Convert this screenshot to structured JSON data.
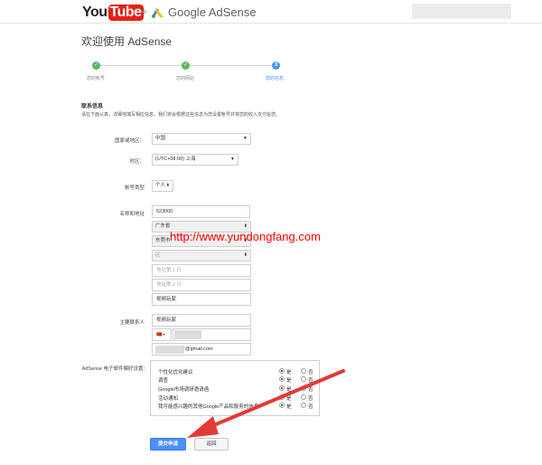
{
  "header": {
    "youtube_you": "You",
    "youtube_tube": "Tube",
    "tm": "™",
    "plus": "+",
    "adsense_title": "Google AdSense"
  },
  "page_title": "欢迎使用 AdSense",
  "steps": [
    {
      "label": "您的帐号",
      "status": "done",
      "mark": "✓"
    },
    {
      "label": "您的网站",
      "status": "done",
      "mark": "✓"
    },
    {
      "label": "您的信息",
      "status": "current",
      "mark": "3"
    }
  ],
  "contact": {
    "heading": "联系信息",
    "description": "请在下面认真，详细地填写相应信息。我们将会根据这些信息为您设置帐号并将您的收入支付给您。",
    "country_label": "国家或地区：",
    "country_value": "中国",
    "timezone_label": "时区：",
    "timezone_value": "(UTC+08:00) 上海",
    "account_type_label": "帐号类型",
    "account_type_value": "个人",
    "name_address_label": "名称和地址",
    "postal_code": "523000",
    "province": "广东省",
    "city": "东莞市",
    "district": "区",
    "address_line1_placeholder": "地址第 1 行",
    "address_line2_placeholder": "地址第 2 行",
    "name_value": "视频玩家",
    "primary_contact_label": "主要联系人",
    "contact_name": "视频玩家",
    "phone_flag": "🇨🇳",
    "email_suffix": "@gmail.com"
  },
  "email_prefs": {
    "label": "AdSense 电子邮件偏好设置：",
    "yes": "是",
    "no": "否",
    "rows": [
      {
        "label": "个性化优化建议",
        "value": "yes"
      },
      {
        "label": "调查",
        "value": "yes"
      },
      {
        "label": "Google市场调研邀请函",
        "value": "yes"
      },
      {
        "label": "活动通知",
        "value": "yes"
      },
      {
        "label": "我可能感兴趣的其他Google产品和服务的信息",
        "value": "yes"
      }
    ]
  },
  "buttons": {
    "submit": "提交申请",
    "back": "返回"
  },
  "watermark": "http://www.yundongfang.com",
  "colors": {
    "accent": "#4d90fe",
    "done_green": "#5cb85c",
    "youtube_red": "#e62117",
    "watermark_red": "#ff0000",
    "arrow_red": "#e53935"
  }
}
